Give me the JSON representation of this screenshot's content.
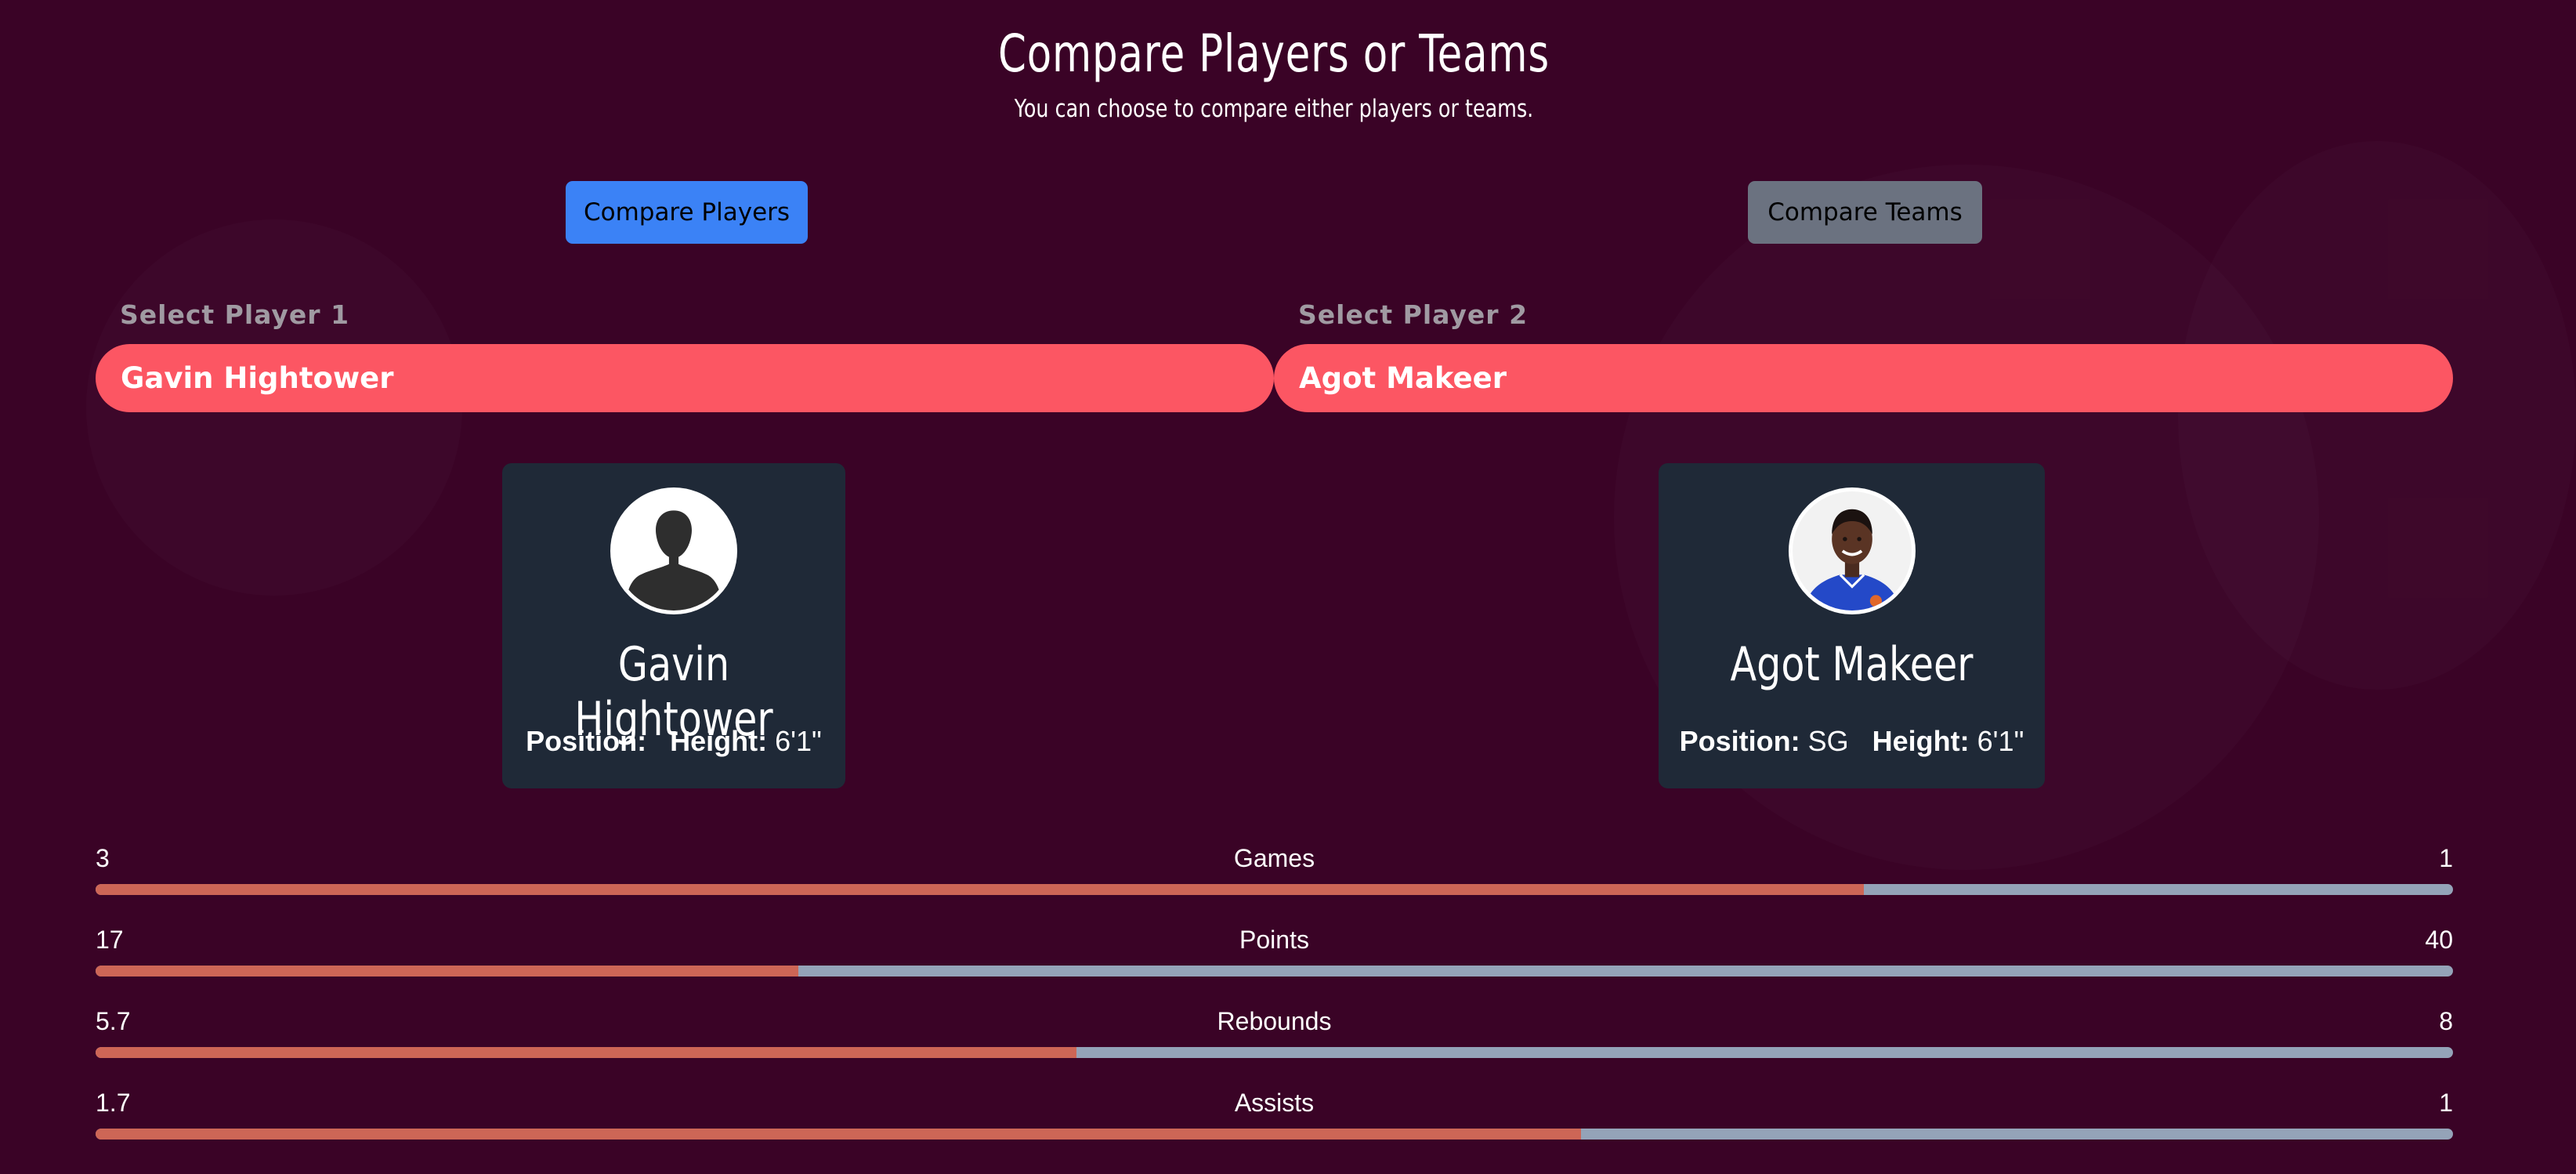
{
  "header": {
    "title": "Compare Players or Teams",
    "subtitle": "You can choose to compare either players or teams."
  },
  "mode_buttons": {
    "players_label": "Compare Players",
    "teams_label": "Compare Teams",
    "active": "players"
  },
  "selectors": {
    "player1_label": "Select Player 1",
    "player1_value": "Gavin Hightower",
    "player2_label": "Select Player 2",
    "player2_value": "Agot Makeer"
  },
  "players": [
    {
      "name": "Gavin Hightower",
      "position_label": "Position:",
      "position_value": "",
      "height_label": "Height:",
      "height_value": "6'1\"",
      "avatar_icon": "default-silhouette-icon"
    },
    {
      "name": "Agot Makeer",
      "position_label": "Position:",
      "position_value": "SG",
      "height_label": "Height:",
      "height_value": "6'1\"",
      "avatar_icon": "player-photo"
    }
  ],
  "stats": [
    {
      "label": "Games",
      "left": "3",
      "right": "1",
      "left_share": 0.75
    },
    {
      "label": "Points",
      "left": "17",
      "right": "40",
      "left_share": 0.298
    },
    {
      "label": "Rebounds",
      "left": "5.7",
      "right": "8",
      "left_share": 0.416
    },
    {
      "label": "Assists",
      "left": "1.7",
      "right": "1",
      "left_share": 0.63
    }
  ],
  "colors": {
    "background": "#3a0326",
    "accent_select": "#fc5663",
    "button_active": "#3b82f6",
    "button_inactive": "#6b7280",
    "card": "#1f2937",
    "bar_left": "#cd6656",
    "bar_right": "#94a3b8"
  }
}
